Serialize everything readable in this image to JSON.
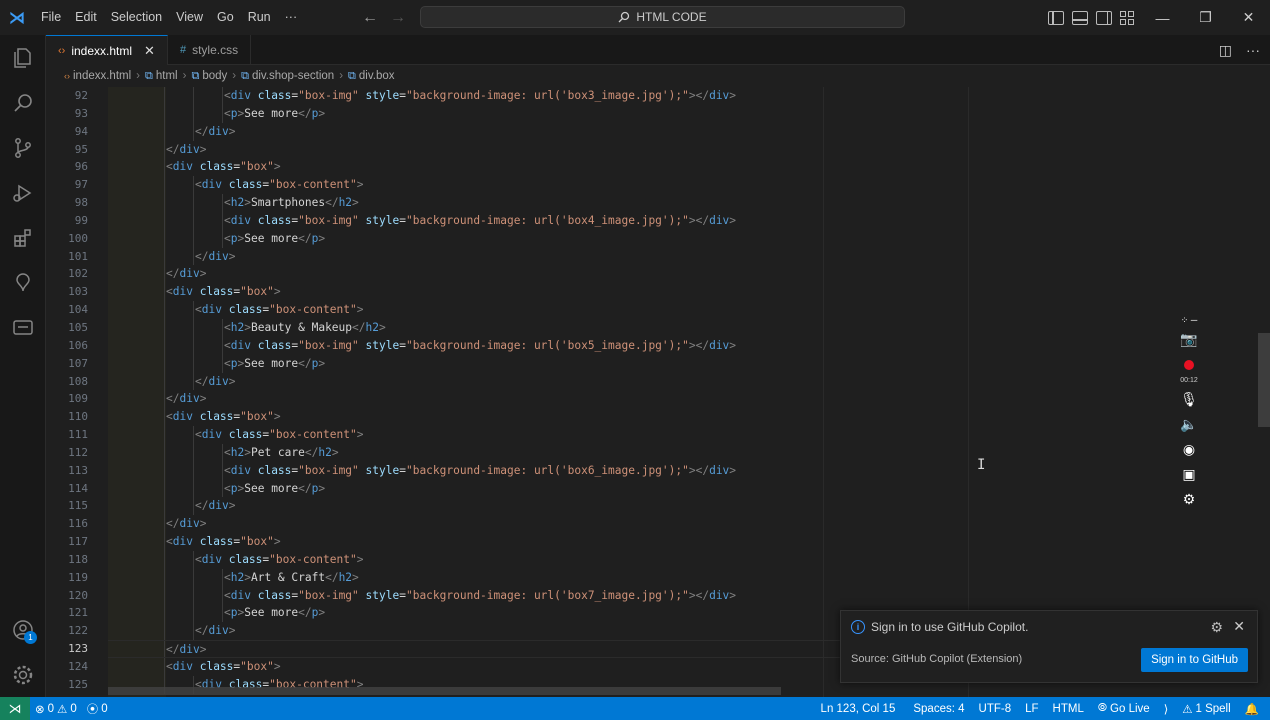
{
  "menu": [
    "File",
    "Edit",
    "Selection",
    "View",
    "Go",
    "Run",
    "···"
  ],
  "search": {
    "text": "HTML CODE"
  },
  "tabs": [
    {
      "label": "indexx.html",
      "icon": "<>",
      "active": true
    },
    {
      "label": "style.css",
      "icon": "#",
      "active": false
    }
  ],
  "breadcrumb": [
    "indexx.html",
    "html",
    "body",
    "div.shop-section",
    "div.box"
  ],
  "editor": {
    "current_line": 123,
    "lines": [
      {
        "n": "92",
        "indent": 2,
        "parts": [
          [
            "tg",
            "<"
          ],
          [
            "tn",
            "div"
          ],
          [
            "tx",
            " "
          ],
          [
            "an",
            "class"
          ],
          [
            "tx",
            "="
          ],
          [
            "av",
            "\"box-img\""
          ],
          [
            "tx",
            " "
          ],
          [
            "an",
            "style"
          ],
          [
            "tx",
            "="
          ],
          [
            "av",
            "\"background-image: url('box3_image.jpg');\""
          ],
          [
            "tg",
            "></"
          ],
          [
            "tn",
            "div"
          ],
          [
            "tg",
            ">"
          ]
        ]
      },
      {
        "n": "93",
        "indent": 2,
        "parts": [
          [
            "tg",
            "<"
          ],
          [
            "tn",
            "p"
          ],
          [
            "tg",
            ">"
          ],
          [
            "tx",
            "See more"
          ],
          [
            "tg",
            "</"
          ],
          [
            "tn",
            "p"
          ],
          [
            "tg",
            ">"
          ]
        ]
      },
      {
        "n": "94",
        "indent": 1,
        "parts": [
          [
            "tg",
            "</"
          ],
          [
            "tn",
            "div"
          ],
          [
            "tg",
            ">"
          ]
        ]
      },
      {
        "n": "95",
        "indent": 0,
        "parts": [
          [
            "tg",
            "</"
          ],
          [
            "tn",
            "div"
          ],
          [
            "tg",
            ">"
          ]
        ]
      },
      {
        "n": "96",
        "indent": 0,
        "parts": [
          [
            "tg",
            "<"
          ],
          [
            "tn",
            "div"
          ],
          [
            "tx",
            " "
          ],
          [
            "an",
            "class"
          ],
          [
            "tx",
            "="
          ],
          [
            "av",
            "\"box\""
          ],
          [
            "tg",
            ">"
          ]
        ]
      },
      {
        "n": "97",
        "indent": 1,
        "parts": [
          [
            "tg",
            "<"
          ],
          [
            "tn",
            "div"
          ],
          [
            "tx",
            " "
          ],
          [
            "an",
            "class"
          ],
          [
            "tx",
            "="
          ],
          [
            "av",
            "\"box-content\""
          ],
          [
            "tg",
            ">"
          ]
        ]
      },
      {
        "n": "98",
        "indent": 2,
        "parts": [
          [
            "tg",
            "<"
          ],
          [
            "tn",
            "h2"
          ],
          [
            "tg",
            ">"
          ],
          [
            "tx",
            "Smartphones"
          ],
          [
            "tg",
            "</"
          ],
          [
            "tn",
            "h2"
          ],
          [
            "tg",
            ">"
          ]
        ]
      },
      {
        "n": "99",
        "indent": 2,
        "parts": [
          [
            "tg",
            "<"
          ],
          [
            "tn",
            "div"
          ],
          [
            "tx",
            " "
          ],
          [
            "an",
            "class"
          ],
          [
            "tx",
            "="
          ],
          [
            "av",
            "\"box-img\""
          ],
          [
            "tx",
            " "
          ],
          [
            "an",
            "style"
          ],
          [
            "tx",
            "="
          ],
          [
            "av",
            "\"background-image: url('box4_image.jpg');\""
          ],
          [
            "tg",
            "></"
          ],
          [
            "tn",
            "div"
          ],
          [
            "tg",
            ">"
          ]
        ]
      },
      {
        "n": "100",
        "indent": 2,
        "parts": [
          [
            "tg",
            "<"
          ],
          [
            "tn",
            "p"
          ],
          [
            "tg",
            ">"
          ],
          [
            "tx",
            "See more"
          ],
          [
            "tg",
            "</"
          ],
          [
            "tn",
            "p"
          ],
          [
            "tg",
            ">"
          ]
        ]
      },
      {
        "n": "101",
        "indent": 1,
        "parts": [
          [
            "tg",
            "</"
          ],
          [
            "tn",
            "div"
          ],
          [
            "tg",
            ">"
          ]
        ]
      },
      {
        "n": "102",
        "indent": 0,
        "parts": [
          [
            "tg",
            "</"
          ],
          [
            "tn",
            "div"
          ],
          [
            "tg",
            ">"
          ]
        ]
      },
      {
        "n": "103",
        "indent": 0,
        "parts": [
          [
            "tg",
            "<"
          ],
          [
            "tn",
            "div"
          ],
          [
            "tx",
            " "
          ],
          [
            "an",
            "class"
          ],
          [
            "tx",
            "="
          ],
          [
            "av",
            "\"box\""
          ],
          [
            "tg",
            ">"
          ]
        ]
      },
      {
        "n": "104",
        "indent": 1,
        "parts": [
          [
            "tg",
            "<"
          ],
          [
            "tn",
            "div"
          ],
          [
            "tx",
            " "
          ],
          [
            "an",
            "class"
          ],
          [
            "tx",
            "="
          ],
          [
            "av",
            "\"box-content\""
          ],
          [
            "tg",
            ">"
          ]
        ]
      },
      {
        "n": "105",
        "indent": 2,
        "parts": [
          [
            "tg",
            "<"
          ],
          [
            "tn",
            "h2"
          ],
          [
            "tg",
            ">"
          ],
          [
            "tx",
            "Beauty & Makeup"
          ],
          [
            "tg",
            "</"
          ],
          [
            "tn",
            "h2"
          ],
          [
            "tg",
            ">"
          ]
        ]
      },
      {
        "n": "106",
        "indent": 2,
        "parts": [
          [
            "tg",
            "<"
          ],
          [
            "tn",
            "div"
          ],
          [
            "tx",
            " "
          ],
          [
            "an",
            "class"
          ],
          [
            "tx",
            "="
          ],
          [
            "av",
            "\"box-img\""
          ],
          [
            "tx",
            " "
          ],
          [
            "an",
            "style"
          ],
          [
            "tx",
            "="
          ],
          [
            "av",
            "\"background-image: url('box5_image.jpg');\""
          ],
          [
            "tg",
            "></"
          ],
          [
            "tn",
            "div"
          ],
          [
            "tg",
            ">"
          ]
        ]
      },
      {
        "n": "107",
        "indent": 2,
        "parts": [
          [
            "tg",
            "<"
          ],
          [
            "tn",
            "p"
          ],
          [
            "tg",
            ">"
          ],
          [
            "tx",
            "See more"
          ],
          [
            "tg",
            "</"
          ],
          [
            "tn",
            "p"
          ],
          [
            "tg",
            ">"
          ]
        ]
      },
      {
        "n": "108",
        "indent": 1,
        "parts": [
          [
            "tg",
            "</"
          ],
          [
            "tn",
            "div"
          ],
          [
            "tg",
            ">"
          ]
        ]
      },
      {
        "n": "109",
        "indent": 0,
        "parts": [
          [
            "tg",
            "</"
          ],
          [
            "tn",
            "div"
          ],
          [
            "tg",
            ">"
          ]
        ]
      },
      {
        "n": "110",
        "indent": 0,
        "parts": [
          [
            "tg",
            "<"
          ],
          [
            "tn",
            "div"
          ],
          [
            "tx",
            " "
          ],
          [
            "an",
            "class"
          ],
          [
            "tx",
            "="
          ],
          [
            "av",
            "\"box\""
          ],
          [
            "tg",
            ">"
          ]
        ]
      },
      {
        "n": "111",
        "indent": 1,
        "parts": [
          [
            "tg",
            "<"
          ],
          [
            "tn",
            "div"
          ],
          [
            "tx",
            " "
          ],
          [
            "an",
            "class"
          ],
          [
            "tx",
            "="
          ],
          [
            "av",
            "\"box-content\""
          ],
          [
            "tg",
            ">"
          ]
        ]
      },
      {
        "n": "112",
        "indent": 2,
        "parts": [
          [
            "tg",
            "<"
          ],
          [
            "tn",
            "h2"
          ],
          [
            "tg",
            ">"
          ],
          [
            "tx",
            "Pet care"
          ],
          [
            "tg",
            "</"
          ],
          [
            "tn",
            "h2"
          ],
          [
            "tg",
            ">"
          ]
        ]
      },
      {
        "n": "113",
        "indent": 2,
        "parts": [
          [
            "tg",
            "<"
          ],
          [
            "tn",
            "div"
          ],
          [
            "tx",
            " "
          ],
          [
            "an",
            "class"
          ],
          [
            "tx",
            "="
          ],
          [
            "av",
            "\"box-img\""
          ],
          [
            "tx",
            " "
          ],
          [
            "an",
            "style"
          ],
          [
            "tx",
            "="
          ],
          [
            "av",
            "\"background-image: url('box6_image.jpg');\""
          ],
          [
            "tg",
            "></"
          ],
          [
            "tn",
            "div"
          ],
          [
            "tg",
            ">"
          ]
        ]
      },
      {
        "n": "114",
        "indent": 2,
        "parts": [
          [
            "tg",
            "<"
          ],
          [
            "tn",
            "p"
          ],
          [
            "tg",
            ">"
          ],
          [
            "tx",
            "See more"
          ],
          [
            "tg",
            "</"
          ],
          [
            "tn",
            "p"
          ],
          [
            "tg",
            ">"
          ]
        ]
      },
      {
        "n": "115",
        "indent": 1,
        "parts": [
          [
            "tg",
            "</"
          ],
          [
            "tn",
            "div"
          ],
          [
            "tg",
            ">"
          ]
        ]
      },
      {
        "n": "116",
        "indent": 0,
        "parts": [
          [
            "tg",
            "</"
          ],
          [
            "tn",
            "div"
          ],
          [
            "tg",
            ">"
          ]
        ]
      },
      {
        "n": "117",
        "indent": 0,
        "parts": [
          [
            "tg",
            "<"
          ],
          [
            "tn",
            "div"
          ],
          [
            "tx",
            " "
          ],
          [
            "an",
            "class"
          ],
          [
            "tx",
            "="
          ],
          [
            "av",
            "\"box\""
          ],
          [
            "tg",
            ">"
          ]
        ]
      },
      {
        "n": "118",
        "indent": 1,
        "parts": [
          [
            "tg",
            "<"
          ],
          [
            "tn",
            "div"
          ],
          [
            "tx",
            " "
          ],
          [
            "an",
            "class"
          ],
          [
            "tx",
            "="
          ],
          [
            "av",
            "\"box-content\""
          ],
          [
            "tg",
            ">"
          ]
        ]
      },
      {
        "n": "119",
        "indent": 2,
        "parts": [
          [
            "tg",
            "<"
          ],
          [
            "tn",
            "h2"
          ],
          [
            "tg",
            ">"
          ],
          [
            "tx",
            "Art & Craft"
          ],
          [
            "tg",
            "</"
          ],
          [
            "tn",
            "h2"
          ],
          [
            "tg",
            ">"
          ]
        ]
      },
      {
        "n": "120",
        "indent": 2,
        "parts": [
          [
            "tg",
            "<"
          ],
          [
            "tn",
            "div"
          ],
          [
            "tx",
            " "
          ],
          [
            "an",
            "class"
          ],
          [
            "tx",
            "="
          ],
          [
            "av",
            "\"box-img\""
          ],
          [
            "tx",
            " "
          ],
          [
            "an",
            "style"
          ],
          [
            "tx",
            "="
          ],
          [
            "av",
            "\"background-image: url('box7_image.jpg');\""
          ],
          [
            "tg",
            "></"
          ],
          [
            "tn",
            "div"
          ],
          [
            "tg",
            ">"
          ]
        ]
      },
      {
        "n": "121",
        "indent": 2,
        "parts": [
          [
            "tg",
            "<"
          ],
          [
            "tn",
            "p"
          ],
          [
            "tg",
            ">"
          ],
          [
            "tx",
            "See more"
          ],
          [
            "tg",
            "</"
          ],
          [
            "tn",
            "p"
          ],
          [
            "tg",
            ">"
          ]
        ]
      },
      {
        "n": "122",
        "indent": 1,
        "parts": [
          [
            "tg",
            "</"
          ],
          [
            "tn",
            "div"
          ],
          [
            "tg",
            ">"
          ]
        ]
      },
      {
        "n": "123",
        "indent": 0,
        "parts": [
          [
            "tg",
            "</"
          ],
          [
            "tn",
            "div"
          ],
          [
            "tg",
            ">"
          ]
        ]
      },
      {
        "n": "124",
        "indent": 0,
        "parts": [
          [
            "tg",
            "<"
          ],
          [
            "tn",
            "div"
          ],
          [
            "tx",
            " "
          ],
          [
            "an",
            "class"
          ],
          [
            "tx",
            "="
          ],
          [
            "av",
            "\"box\""
          ],
          [
            "tg",
            ">"
          ]
        ]
      },
      {
        "n": "125",
        "indent": 1,
        "parts": [
          [
            "tg",
            "<"
          ],
          [
            "tn",
            "div"
          ],
          [
            "tx",
            " "
          ],
          [
            "an",
            "class"
          ],
          [
            "tx",
            "="
          ],
          [
            "av",
            "\"box-content\""
          ],
          [
            "tg",
            ">"
          ]
        ]
      }
    ]
  },
  "recorder": {
    "time": "00:12"
  },
  "notification": {
    "message": "Sign in to use GitHub Copilot.",
    "source": "Source: GitHub Copilot (Extension)",
    "button": "Sign in to GitHub"
  },
  "activity_badge": "1",
  "statusbar": {
    "errors": "0",
    "warnings": "0",
    "ports": "0",
    "position": "Ln 123, Col 15",
    "spaces": "Spaces: 4",
    "encoding": "UTF-8",
    "eol": "LF",
    "language": "HTML",
    "golive": "Go Live",
    "spell": "1 Spell"
  },
  "colors": {
    "accent": "#0078d4",
    "status_bar": "#0078d4",
    "remote": "#16825d"
  }
}
